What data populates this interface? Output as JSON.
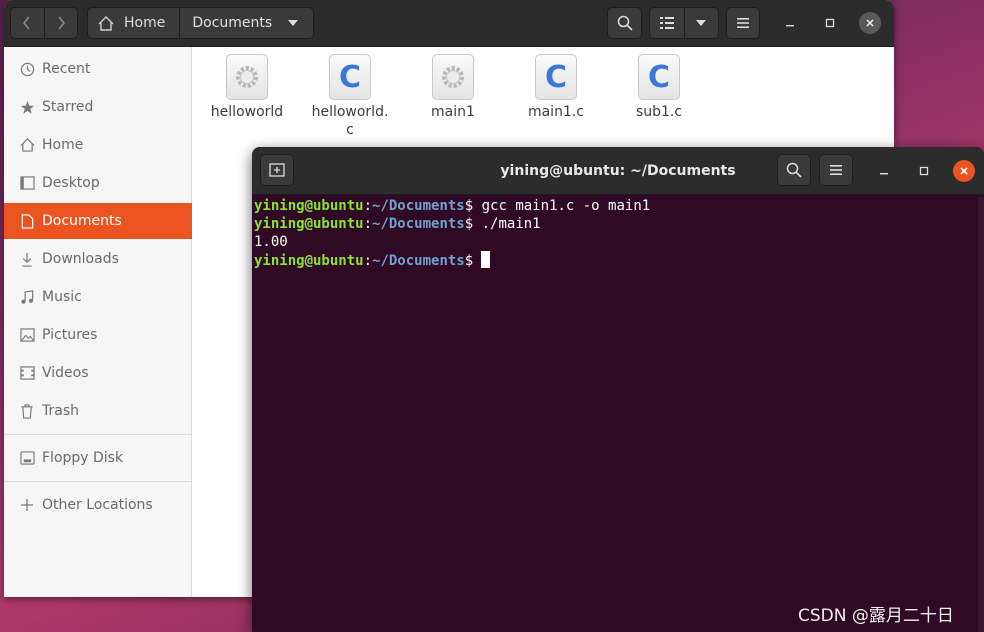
{
  "file_manager": {
    "path": {
      "home_label": "Home",
      "current_label": "Documents"
    },
    "sidebar": {
      "items": [
        {
          "label": "Recent",
          "icon": "clock-icon"
        },
        {
          "label": "Starred",
          "icon": "star-icon"
        },
        {
          "label": "Home",
          "icon": "home-icon"
        },
        {
          "label": "Desktop",
          "icon": "desktop-icon"
        },
        {
          "label": "Documents",
          "icon": "document-icon",
          "active": true
        },
        {
          "label": "Downloads",
          "icon": "download-icon"
        },
        {
          "label": "Music",
          "icon": "music-icon"
        },
        {
          "label": "Pictures",
          "icon": "pictures-icon"
        },
        {
          "label": "Videos",
          "icon": "video-icon"
        },
        {
          "label": "Trash",
          "icon": "trash-icon"
        },
        {
          "label": "Floppy Disk",
          "icon": "disk-icon"
        },
        {
          "label": "Other Locations",
          "icon": "plus-icon"
        }
      ]
    },
    "files": [
      {
        "name": "helloworld",
        "type": "executable"
      },
      {
        "name": "helloworld.c",
        "name_line1": "helloworld.",
        "name_line2": "c",
        "type": "c-source",
        "letter": "C"
      },
      {
        "name": "main1",
        "type": "executable"
      },
      {
        "name": "main1.c",
        "type": "c-source",
        "letter": "C"
      },
      {
        "name": "sub1.c",
        "type": "c-source",
        "letter": "C"
      }
    ]
  },
  "terminal": {
    "title": "yining@ubuntu: ~/Documents",
    "lines": [
      {
        "user": "yining@ubuntu",
        "sep": ":",
        "path": "~/Documents",
        "prompt": "$",
        "command": " gcc main1.c -o main1"
      },
      {
        "user": "yining@ubuntu",
        "sep": ":",
        "path": "~/Documents",
        "prompt": "$",
        "command": " ./main1"
      },
      {
        "output": "1.00"
      },
      {
        "user": "yining@ubuntu",
        "sep": ":",
        "path": "~/Documents",
        "prompt": "$",
        "command": ""
      }
    ]
  },
  "watermark": "CSDN @露月二十日",
  "colors": {
    "accent": "#e95420",
    "terminal_bg": "#300a24",
    "prompt_user": "#8ae234",
    "prompt_path": "#729fcf",
    "c_icon": "#3b78d8"
  }
}
